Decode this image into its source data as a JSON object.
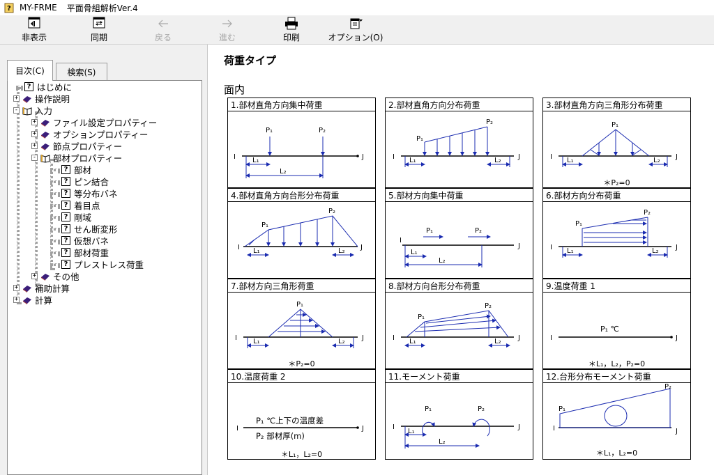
{
  "window": {
    "app_name": "MY-FRME",
    "subtitle": "平面骨組解析Ver.4"
  },
  "toolbar": {
    "hide_label": "非表示",
    "sync_label": "同期",
    "back_label": "戻る",
    "forward_label": "進む",
    "print_label": "印刷",
    "options_label": "オプション(O)"
  },
  "tabs": {
    "contents": "目次(C)",
    "search": "検索(S)"
  },
  "tree": {
    "intro": "はじめに",
    "operation": "操作説明",
    "input": "入力",
    "file_props": "ファイル設定プロパティー",
    "option_props": "オプションプロパティー",
    "node_props": "節点プロパティー",
    "member_props": "部材プロパティー",
    "member": "部材",
    "pin": "ピン結合",
    "spring": "等分布バネ",
    "focus": "着目点",
    "rigid": "剛域",
    "shear": "せん断変形",
    "virtual_spring": "仮想バネ",
    "member_load": "部材荷重",
    "prestress": "プレストレス荷重",
    "other": "その他",
    "aux_calc": "補助計算",
    "calc": "計算"
  },
  "main": {
    "title": "荷重タイプ",
    "section": "面内",
    "cells": [
      {
        "label": "1.部材直角方向集中荷重"
      },
      {
        "label": "2.部材直角方向分布荷重"
      },
      {
        "label": "3.部材直角方向三角形分布荷重",
        "note": "＊P₂=0"
      },
      {
        "label": "4.部材直角方向台形分布荷重"
      },
      {
        "label": "5.部材方向集中荷重"
      },
      {
        "label": "6.部材方向分布荷重"
      },
      {
        "label": "7.部材方向三角形荷重",
        "note": "＊P₂=0"
      },
      {
        "label": "8.部材方向台形分布荷重"
      },
      {
        "label": "9.温度荷重 1",
        "note": "＊L₁，L₂，P₂=0",
        "text1": "P₁ ℃"
      },
      {
        "label": "10.温度荷重 2",
        "note": "＊L₁，L₂=0",
        "text1": "P₁ ℃上下の温度差",
        "text2": "P₂ 部材厚(m)"
      },
      {
        "label": "11.モーメント荷重"
      },
      {
        "label": "12.台形分布モーメント荷重",
        "note": "＊L₁，L₂=0"
      }
    ]
  },
  "symbols": {
    "i": "I",
    "j": "J",
    "p1": "P₁",
    "p2": "P₂",
    "l1": "L₁",
    "l2": "L₂"
  }
}
